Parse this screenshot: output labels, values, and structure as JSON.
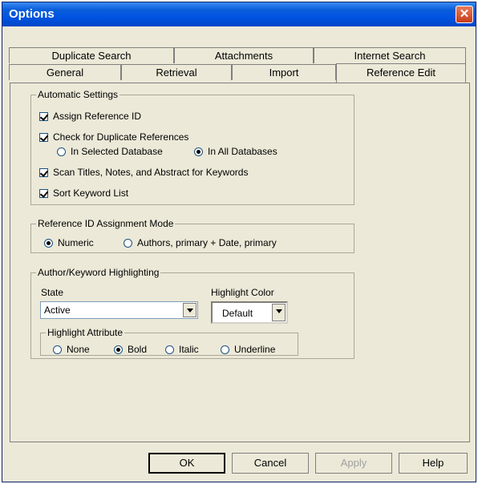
{
  "window": {
    "title": "Options"
  },
  "tabs": {
    "row1": [
      "Duplicate Search",
      "Attachments",
      "Internet Search"
    ],
    "row2": [
      "General",
      "Retrieval",
      "Import",
      "Reference Edit"
    ],
    "active": "Reference Edit"
  },
  "automatic_settings": {
    "title": "Automatic Settings",
    "assign_ref_id": {
      "label": "Assign Reference ID",
      "checked": true
    },
    "check_duplicates": {
      "label": "Check for Duplicate References",
      "checked": true
    },
    "dup_scope": {
      "options": [
        "In Selected Database",
        "In All Databases"
      ],
      "selected": "In All Databases"
    },
    "scan_titles": {
      "label": "Scan Titles, Notes, and Abstract for Keywords",
      "checked": true
    },
    "sort_keywords": {
      "label": "Sort Keyword List",
      "checked": true
    }
  },
  "ref_id_mode": {
    "title": "Reference ID Assignment Mode",
    "options": [
      "Numeric",
      "Authors, primary + Date, primary"
    ],
    "selected": "Numeric"
  },
  "highlighting": {
    "title": "Author/Keyword Highlighting",
    "state_label": "State",
    "state_value": "Active",
    "color_label": "Highlight Color",
    "color_value": "Default",
    "attribute": {
      "title": "Highlight Attribute",
      "options": [
        "None",
        "Bold",
        "Italic",
        "Underline"
      ],
      "selected": "Bold"
    }
  },
  "buttons": {
    "ok": "OK",
    "cancel": "Cancel",
    "apply": "Apply",
    "help": "Help"
  },
  "icons": {
    "close": "close-icon"
  },
  "colors": {
    "titlebar": "#0054e3",
    "close": "#c73b1a",
    "dialog_bg": "#ece9d8"
  }
}
